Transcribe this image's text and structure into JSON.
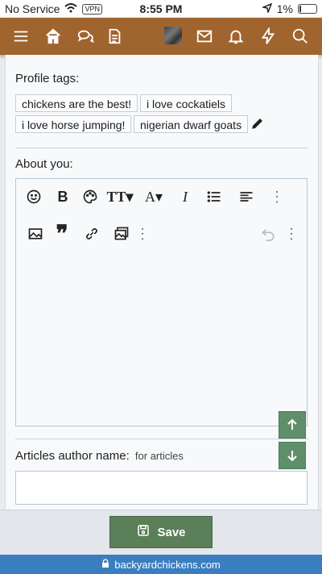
{
  "status_bar": {
    "carrier": "No Service",
    "vpn": "VPN",
    "time": "8:55 PM",
    "battery": "1%"
  },
  "nav": {
    "icons": [
      "menu-icon",
      "home-icon",
      "chat-icon",
      "document-icon",
      "avatar",
      "mail-icon",
      "bell-icon",
      "bolt-icon",
      "search-icon"
    ],
    "accent_color": "#a0642f"
  },
  "profile_tags": {
    "label": "Profile tags:",
    "tags": [
      "chickens are the best!",
      "i love cockatiels",
      "i love horse jumping!",
      "nigerian dwarf goats"
    ]
  },
  "about": {
    "label": "About you:"
  },
  "articles": {
    "label": "Articles author name:",
    "hint": "for articles",
    "value": ""
  },
  "footer": {
    "save_label": "Save",
    "save_color": "#5b7f59"
  },
  "browser": {
    "url": "backyardchickens.com"
  }
}
